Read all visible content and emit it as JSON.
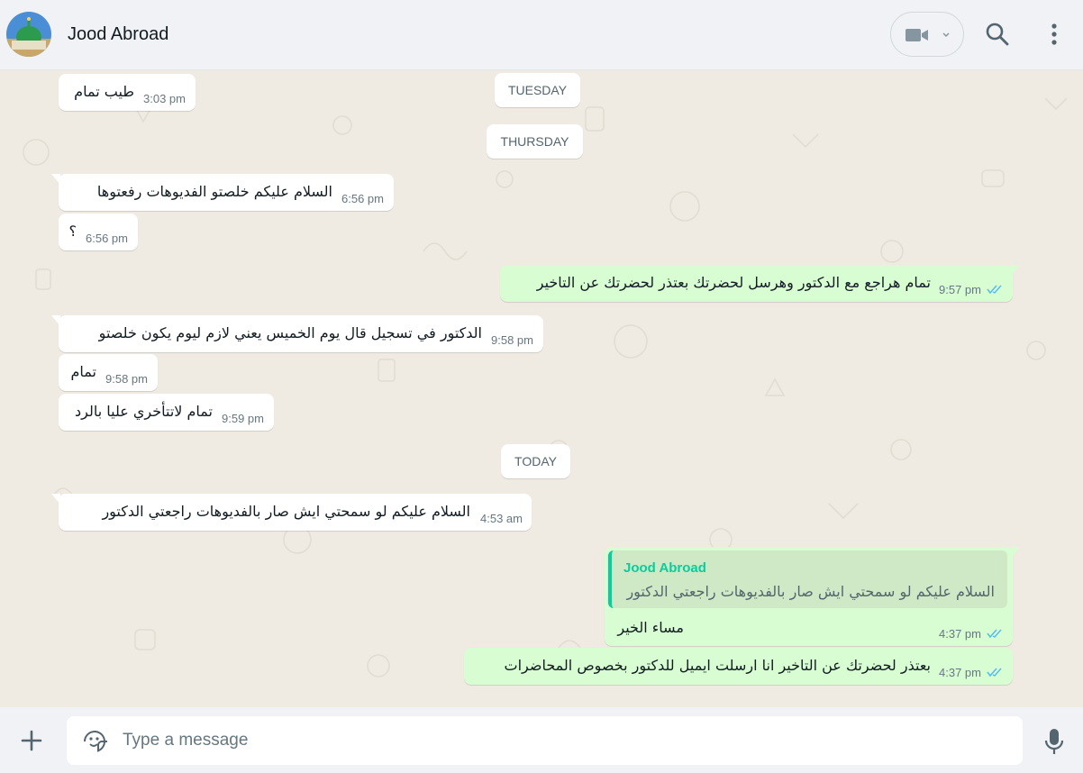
{
  "header": {
    "contact_name": "Jood Abroad"
  },
  "colors": {
    "chat_bg": "#efeae2",
    "incoming_bubble": "#ffffff",
    "outgoing_bubble": "#d9fdd3",
    "read_ticks": "#53bdeb",
    "quote_accent": "#06cf9c"
  },
  "dates": {
    "tuesday": "TUESDAY",
    "thursday": "THURSDAY",
    "today": "TODAY"
  },
  "messages": [
    {
      "dir": "in",
      "text": "طيب تمام",
      "time": "3:03 pm"
    },
    {
      "dir": "in",
      "text": "السلام عليكم  خلصتو الفديوهات رفعتوها",
      "time": "6:56 pm"
    },
    {
      "dir": "in",
      "text": "؟",
      "time": "6:56 pm"
    },
    {
      "dir": "out",
      "text": "تمام هراجع مع الدكتور وهرسل لحضرتك بعتذر لحضرتك عن التاخير",
      "time": "9:57 pm",
      "status": "read"
    },
    {
      "dir": "in",
      "text": "الدكتور في تسجيل قال يوم الخميس يعني لازم ليوم يكون خلصتو",
      "time": "9:58 pm"
    },
    {
      "dir": "in",
      "text": "تمام",
      "time": "9:58 pm"
    },
    {
      "dir": "in",
      "text": "تمام لاتتأخري عليا بالرد",
      "time": "9:59 pm"
    },
    {
      "dir": "in",
      "text": "السلام عليكم  لو سمحتي ايش صار بالفديوهات راجعتي الدكتور",
      "time": "4:53 am"
    },
    {
      "dir": "out",
      "text": "مساء الخير",
      "time": "4:37 pm",
      "status": "read"
    },
    {
      "dir": "out",
      "text": "بعتذر لحضرتك عن التاخير انا ارسلت ايميل للدكتور بخصوص المحاضرات",
      "time": "4:37 pm",
      "status": "read"
    }
  ],
  "quote": {
    "author": "Jood Abroad",
    "text": "السلام عليكم  لو سمحتي ايش صار بالفديوهات راجعتي الدكتور"
  },
  "composer": {
    "placeholder": "Type a message"
  },
  "icons": [
    "video-call-icon",
    "chevron-down-icon",
    "search-icon",
    "menu-icon",
    "attach-icon",
    "sticker-icon",
    "mic-icon",
    "double-check-icon"
  ]
}
